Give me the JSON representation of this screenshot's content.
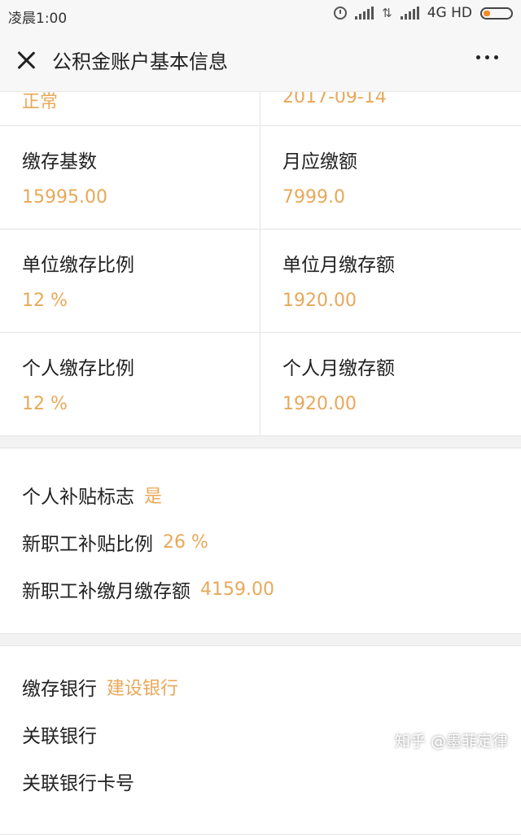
{
  "status": {
    "time": "凌晨1:00",
    "network": "4G HD"
  },
  "header": {
    "title": "公积金账户基本信息"
  },
  "grid": {
    "partial": {
      "left_value": "正常",
      "right_value": "2017-09-14"
    },
    "rows": [
      {
        "left_label": "缴存基数",
        "left_value": "15995.00",
        "right_label": "月应缴额",
        "right_value": "7999.0"
      },
      {
        "left_label": "单位缴存比例",
        "left_value": "12 %",
        "right_label": "单位月缴存额",
        "right_value": "1920.00"
      },
      {
        "left_label": "个人缴存比例",
        "left_value": "12 %",
        "right_label": "个人月缴存额",
        "right_value": "1920.00"
      }
    ]
  },
  "subsidy": {
    "items": [
      {
        "label": "个人补贴标志",
        "value": "是"
      },
      {
        "label": "新职工补贴比例",
        "value": "26 %"
      },
      {
        "label": "新职工补缴月缴存额",
        "value": "4159.00"
      }
    ]
  },
  "bank": {
    "items": [
      {
        "label": "缴存银行",
        "value": "建设银行"
      },
      {
        "label": "关联银行",
        "value": ""
      },
      {
        "label": "关联银行卡号",
        "value": ""
      }
    ]
  },
  "watermark": "知乎 @墨菲定律",
  "colors": {
    "accent": "#e8a85a",
    "text": "#222222",
    "background": "#f2f2f2"
  }
}
